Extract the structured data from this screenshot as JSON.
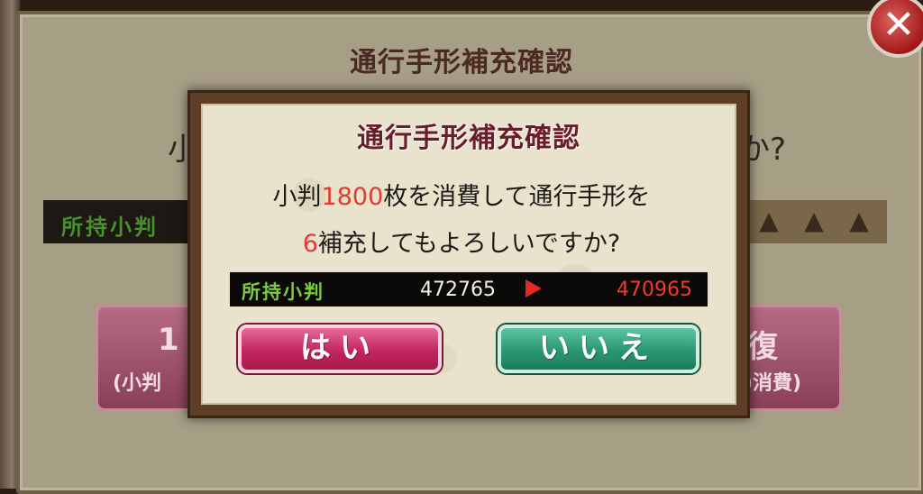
{
  "background_dialog": {
    "title": "通行手形補充確認",
    "question_left": "小",
    "question_right": "か?",
    "coin_label": "所持小判",
    "left_button_big": "1",
    "left_button_small": "(小判",
    "right_button_big": "復",
    "right_button_small": ")消費)",
    "close_glyph": "✕"
  },
  "confirm_dialog": {
    "title": "通行手形補充確認",
    "line1_prefix": "小判",
    "line1_amount": "1800",
    "line1_suffix": "枚を消費して通行手形を",
    "line2_amount": "6",
    "line2_suffix": "補充してもよろしいですか?",
    "coin_label": "所持小判",
    "coin_before": "472765",
    "coin_after": "470965",
    "yes_label": "はい",
    "no_label": "いいえ"
  },
  "colors": {
    "highlight_red": "#e03a32",
    "yes_button": "#c3255f",
    "no_button": "#2a9872",
    "coin_label_green": "#7ccc3a"
  },
  "icons": [
    "close-icon",
    "arrow-right-icon",
    "pass-stamp-icon"
  ]
}
